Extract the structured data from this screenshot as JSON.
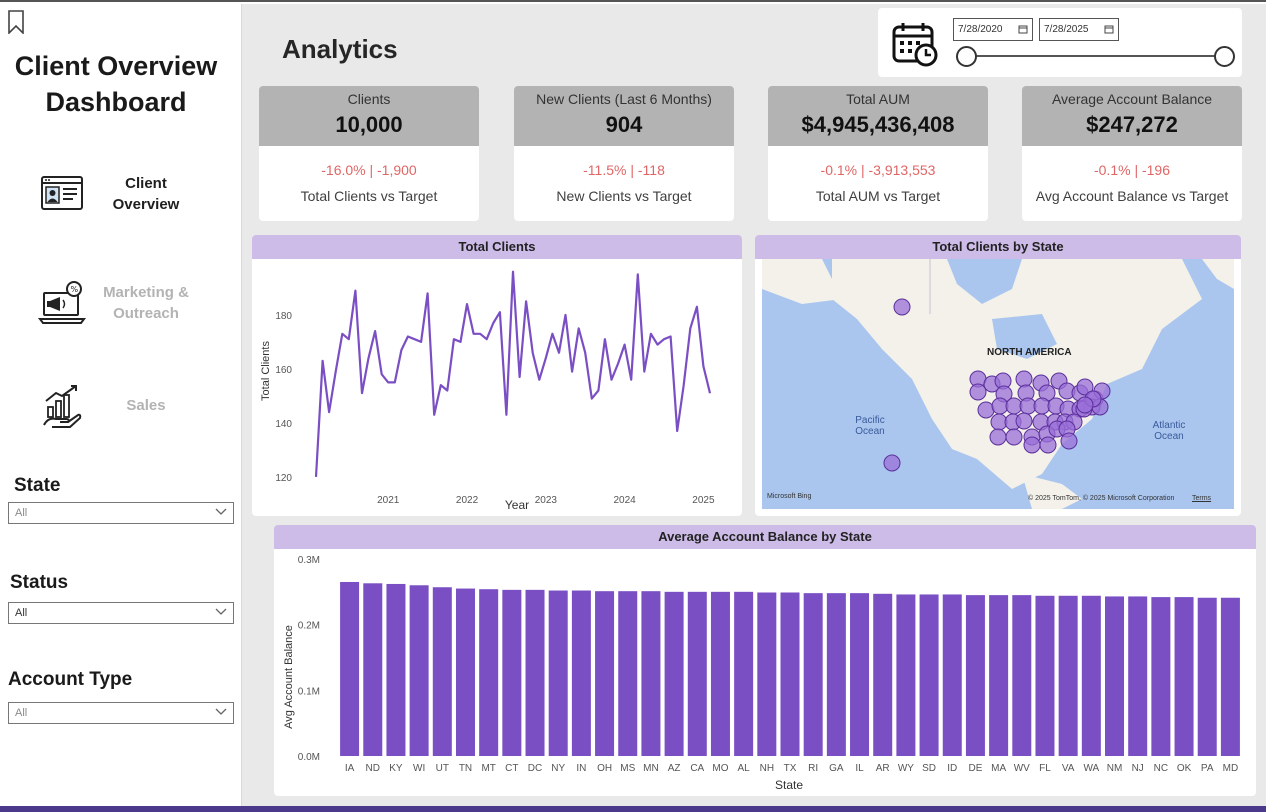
{
  "sidebar": {
    "title_line1": "Client Overview",
    "title_line2": "Dashboard",
    "nav": [
      {
        "label_line1": "Client",
        "label_line2": "Overview",
        "icon": "web-page-profile-icon",
        "active": true
      },
      {
        "label_line1": "Marketing &",
        "label_line2": "Outreach",
        "icon": "megaphone-laptop-icon",
        "active": false
      },
      {
        "label_line1": "Sales",
        "label_line2": "",
        "icon": "growth-hand-icon",
        "active": false
      }
    ],
    "slicers": [
      {
        "label": "State",
        "value": "All"
      },
      {
        "label": "Status",
        "value": "All"
      },
      {
        "label": "Account Type",
        "value": "All"
      }
    ]
  },
  "header": {
    "title": "Analytics",
    "date_from": "7/28/2020",
    "date_to": "7/28/2025"
  },
  "kpis": [
    {
      "label": "Clients",
      "value": "10,000",
      "delta": "-16.0% | -1,900",
      "sub": "Total Clients vs Target"
    },
    {
      "label": "New Clients (Last 6 Months)",
      "value": "904",
      "delta": "-11.5% | -118",
      "sub": "New Clients vs Target"
    },
    {
      "label": "Total AUM",
      "value": "$4,945,436,408",
      "delta": "-0.1% | -3,913,553",
      "sub": "Total AUM vs Target"
    },
    {
      "label": "Average Account Balance",
      "value": "$247,272",
      "delta": "-0.1% | -196",
      "sub": "Avg Account Balance vs Target"
    }
  ],
  "colors": {
    "accent": "#7b4fc4",
    "title_band": "#cdbce8",
    "kpi_head": "#b3b3b3",
    "delta_negative": "#e06666"
  },
  "map": {
    "title": "Total Clients by State",
    "region_label": "NORTH AMERICA",
    "pacific_line1": "Pacific",
    "pacific_line2": "Ocean",
    "atlantic_line1": "Atlantic",
    "atlantic_line2": "Ocean",
    "attribution": "© 2025 TomTom, © 2025 Microsoft Corporation",
    "terms": "Terms",
    "bing": "Microsoft Bing"
  },
  "chart_data": [
    {
      "type": "line",
      "title": "Total Clients",
      "xlabel": "Year",
      "ylabel": "Total Clients",
      "x_ticks": [
        "2021",
        "2022",
        "2023",
        "2024",
        "2025"
      ],
      "y_ticks": [
        120,
        140,
        160,
        180
      ],
      "ylim": [
        117,
        197
      ],
      "x_start": "2020-08",
      "values": [
        120,
        163,
        144,
        159,
        173,
        171,
        189,
        151,
        164,
        174,
        158,
        155,
        155,
        167,
        172,
        171,
        170,
        188,
        143,
        154,
        152,
        171,
        170,
        184,
        173,
        173,
        171,
        177,
        181,
        143,
        196,
        157,
        185,
        166,
        156,
        164,
        173,
        166,
        180,
        159,
        175,
        166,
        149,
        152,
        171,
        156,
        162,
        169,
        156,
        195,
        159,
        173,
        169,
        171,
        172,
        137,
        154,
        175,
        183,
        161,
        151
      ],
      "grid": false
    },
    {
      "type": "bar",
      "title": "Average Account Balance by State",
      "xlabel": "State",
      "ylabel": "Avg Account Balance",
      "y_ticks": [
        "0.0M",
        "0.1M",
        "0.2M",
        "0.3M"
      ],
      "ylim": [
        0,
        0.3
      ],
      "categories": [
        "IA",
        "ND",
        "KY",
        "WI",
        "UT",
        "TN",
        "MT",
        "CT",
        "DC",
        "NY",
        "IN",
        "OH",
        "MS",
        "MN",
        "AZ",
        "CA",
        "MO",
        "AL",
        "NH",
        "TX",
        "RI",
        "GA",
        "IL",
        "AR",
        "WY",
        "SD",
        "ID",
        "DE",
        "MA",
        "WV",
        "FL",
        "VA",
        "WA",
        "NM",
        "NJ",
        "NC",
        "OK",
        "PA",
        "MD"
      ],
      "values": [
        0.265,
        0.263,
        0.262,
        0.26,
        0.257,
        0.255,
        0.254,
        0.253,
        0.253,
        0.252,
        0.252,
        0.251,
        0.251,
        0.251,
        0.25,
        0.25,
        0.25,
        0.25,
        0.249,
        0.249,
        0.248,
        0.248,
        0.248,
        0.247,
        0.246,
        0.246,
        0.246,
        0.245,
        0.245,
        0.245,
        0.244,
        0.244,
        0.244,
        0.243,
        0.243,
        0.242,
        0.242,
        0.241,
        0.241
      ],
      "grid": false
    }
  ]
}
